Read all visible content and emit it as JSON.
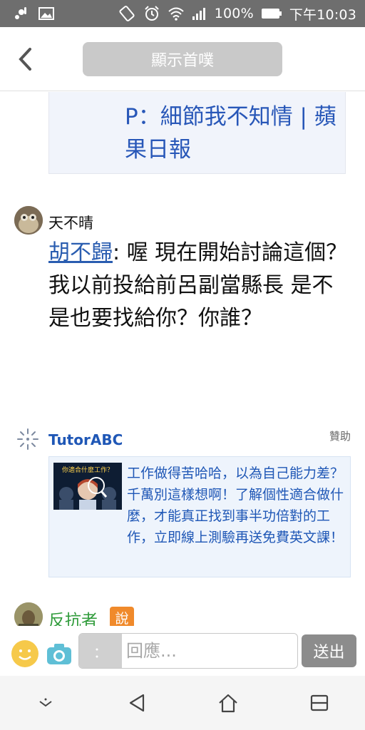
{
  "status_bar": {
    "battery": "100%",
    "time": "下午10:03"
  },
  "header": {
    "home_label": "顯示首噗"
  },
  "quoted_card": {
    "text": "P：細節我不知情 | 蘋果日報"
  },
  "post1": {
    "username": "天不晴",
    "mention": "胡不歸",
    "body": ": 喔 現在開始討論這個？\n我以前投給前呂副當縣長 是不是也要找給你？你誰？"
  },
  "ad": {
    "brand": "TutorABC",
    "sponsored_label": "贊助",
    "thumb_title": "你適合什麼工作？",
    "text": "工作做得苦哈哈，以為自己能力差？千萬別這樣想啊！了解個性適合做什麼，才能真正找到事半功倍對的工作，立即線上測驗再送免費英文課！"
  },
  "post2": {
    "username": "反抗者",
    "qualifier": "說"
  },
  "comment_bar": {
    "prefix": "：",
    "placeholder": "回應...",
    "send_label": "送出"
  },
  "colors": {
    "link_blue": "#2a5db0",
    "status_bar_bg": "#6e6e6e",
    "qualifier_orange": "#f08a2b",
    "username_green": "#2f9b3a"
  }
}
